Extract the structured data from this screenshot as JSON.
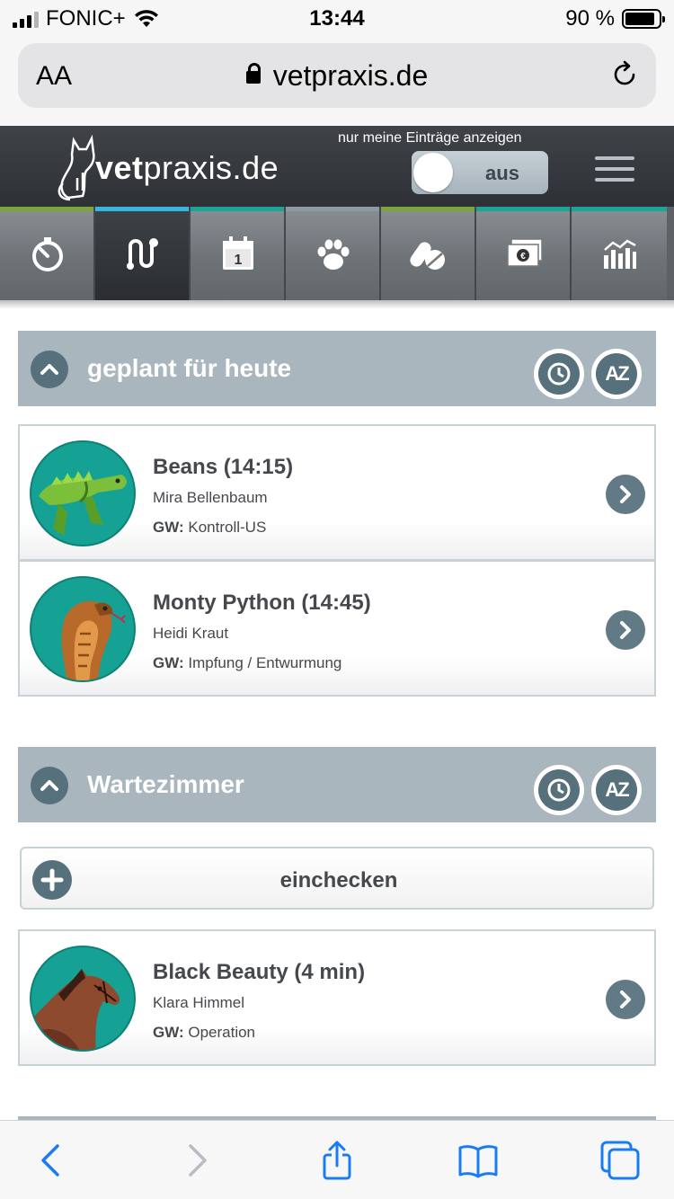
{
  "status_bar": {
    "carrier": "FONIC+",
    "time": "13:44",
    "battery": "90 %"
  },
  "browser": {
    "text_size_label": "AA",
    "url": "vetpraxis.de"
  },
  "header": {
    "logo_text_bold": "vet",
    "logo_text_rest": "praxis.de",
    "toggle_caption": "nur meine Einträge anzeigen",
    "toggle_state": "aus"
  },
  "tabs": [
    {
      "icon": "stopwatch-icon",
      "stripe": "#7fa33b"
    },
    {
      "icon": "route-icon",
      "stripe": "#3ab4e0",
      "active": true
    },
    {
      "icon": "calendar-icon",
      "stripe": "#1aa596"
    },
    {
      "icon": "paw-icon",
      "stripe": "#8c9aa3"
    },
    {
      "icon": "pills-icon",
      "stripe": "#7fa33b"
    },
    {
      "icon": "money-icon",
      "stripe": "#1aa596"
    },
    {
      "icon": "statistics-icon",
      "stripe": "#1aa596"
    }
  ],
  "calendar_day": "1",
  "sections": {
    "today": {
      "title": "geplant für heute",
      "sort_az_label": "AZ",
      "patients": [
        {
          "name": "Beans (14:15)",
          "owner": "Mira Bellenbaum",
          "reason_label": "GW:",
          "reason": "Kontroll-US",
          "avatar": "iguana-icon"
        },
        {
          "name": "Monty Python (14:45)",
          "owner": "Heidi Kraut",
          "reason_label": "GW:",
          "reason": "Impfung / Entwurmung",
          "avatar": "cobra-icon"
        }
      ]
    },
    "waiting": {
      "title": "Wartezimmer",
      "sort_az_label": "AZ",
      "checkin_label": "einchecken",
      "patients": [
        {
          "name": "Black Beauty (4 min)",
          "owner": "Klara Himmel",
          "reason_label": "GW:",
          "reason": "Operation",
          "avatar": "horse-icon"
        }
      ]
    }
  },
  "colors": {
    "section_header": "#a9b6bd",
    "button_dark": "#56707c",
    "avatar_bg": "#15a294",
    "safari_blue": "#1a7cf5"
  }
}
